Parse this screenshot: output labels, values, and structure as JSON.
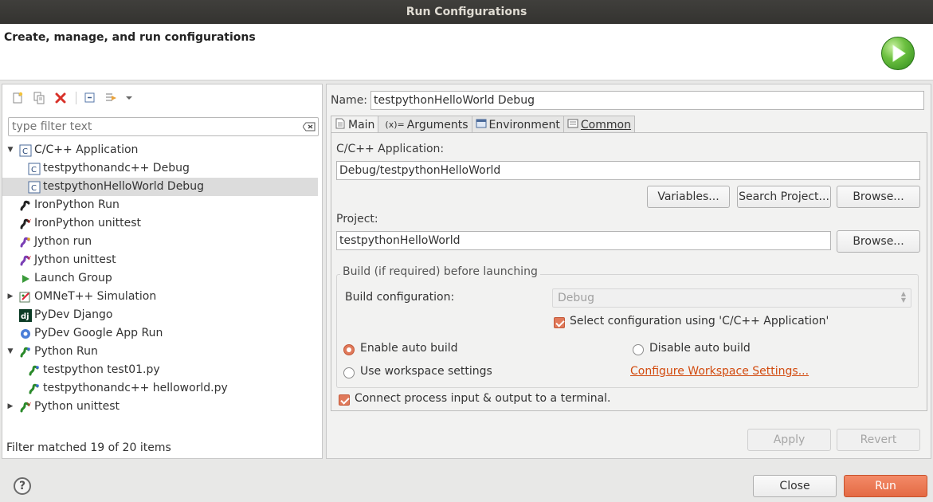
{
  "window": {
    "title": "Run Configurations"
  },
  "header": {
    "title": "Create, manage, and run configurations"
  },
  "left": {
    "filter_placeholder": "type filter text",
    "status": "Filter matched 19 of 20 items",
    "tree": [
      {
        "label": "C/C++ Application",
        "expanded": true,
        "level": 0,
        "icon": "c-app-icon"
      },
      {
        "label": "testpythonandc++ Debug",
        "level": 1,
        "icon": "c-config-icon"
      },
      {
        "label": "testpythonHelloWorld Debug",
        "level": 1,
        "icon": "c-config-icon",
        "selected": true
      },
      {
        "label": "IronPython Run",
        "level": 0,
        "icon": "ironpython-icon"
      },
      {
        "label": "IronPython unittest",
        "level": 0,
        "icon": "ironpython-unittest-icon"
      },
      {
        "label": "Jython run",
        "level": 0,
        "icon": "jython-icon"
      },
      {
        "label": "Jython unittest",
        "level": 0,
        "icon": "jython-unittest-icon"
      },
      {
        "label": "Launch Group",
        "level": 0,
        "icon": "launch-group-icon"
      },
      {
        "label": "OMNeT++ Simulation",
        "level": 0,
        "collapsed": true,
        "icon": "omnet-icon"
      },
      {
        "label": "PyDev Django",
        "level": 0,
        "icon": "django-icon"
      },
      {
        "label": "PyDev Google App Run",
        "level": 0,
        "icon": "google-app-icon"
      },
      {
        "label": "Python Run",
        "expanded": true,
        "level": 0,
        "icon": "python-run-icon"
      },
      {
        "label": "testpython test01.py",
        "level": 1,
        "icon": "python-config-icon"
      },
      {
        "label": "testpythonandc++ helloworld.py",
        "level": 1,
        "icon": "python-config-icon"
      },
      {
        "label": "Python unittest",
        "level": 0,
        "collapsed": true,
        "icon": "python-unittest-icon"
      }
    ]
  },
  "right": {
    "name_label": "Name:",
    "name_value": "testpythonHelloWorld Debug",
    "tabs": [
      {
        "label": "Main",
        "active": true
      },
      {
        "label": "Arguments"
      },
      {
        "label": "Environment"
      },
      {
        "label": "Common"
      }
    ],
    "app_label": "C/C++ Application:",
    "app_value": "Debug/testpythonHelloWorld",
    "variables_btn": "Variables...",
    "search_project_btn": "Search Project...",
    "browse_btn": "Browse...",
    "project_label": "Project:",
    "project_value": "testpythonHelloWorld",
    "build_group_title": "Build (if required) before launching",
    "build_config_label": "Build configuration:",
    "build_config_value": "Debug",
    "select_config_label": "Select configuration using 'C/C++ Application'",
    "enable_auto_build": "Enable auto build",
    "disable_auto_build": "Disable auto build",
    "use_workspace": "Use workspace settings",
    "configure_workspace_link": "Configure Workspace Settings...",
    "connect_terminal": "Connect process input & output to a terminal.",
    "apply_btn": "Apply",
    "revert_btn": "Revert"
  },
  "footer": {
    "close_btn": "Close",
    "run_btn": "Run",
    "help": "?"
  },
  "colors": {
    "accent": "#e46a44",
    "link": "#d24b0f",
    "titlebar": "#3b3a37"
  }
}
